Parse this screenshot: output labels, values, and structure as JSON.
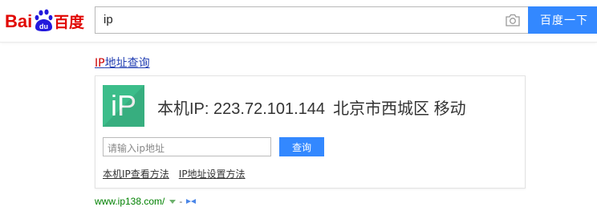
{
  "header": {
    "logo_text": "Bai百度",
    "search_value": "ip",
    "search_button": "百度一下",
    "camera_icon": "camera-icon"
  },
  "result": {
    "title_highlight": "IP",
    "title_rest": "地址查询",
    "card": {
      "logo_text": "iP",
      "ip_label": "本机IP:",
      "ip_value": "223.72.101.144",
      "location": "北京市西城区",
      "isp": "移动",
      "input_placeholder": "请输入ip地址",
      "query_button": "查询",
      "links": [
        "本机IP查看方法",
        "IP地址设置方法"
      ]
    },
    "source_url": "www.ip138.com/",
    "source_dash": "-"
  },
  "colors": {
    "brand_blue": "#3388ff",
    "logo_red": "#e10601",
    "logo_blue": "#2319dc",
    "ip_green": "#3cbd8a",
    "link_blue": "#2440b3",
    "url_green": "#008000"
  }
}
